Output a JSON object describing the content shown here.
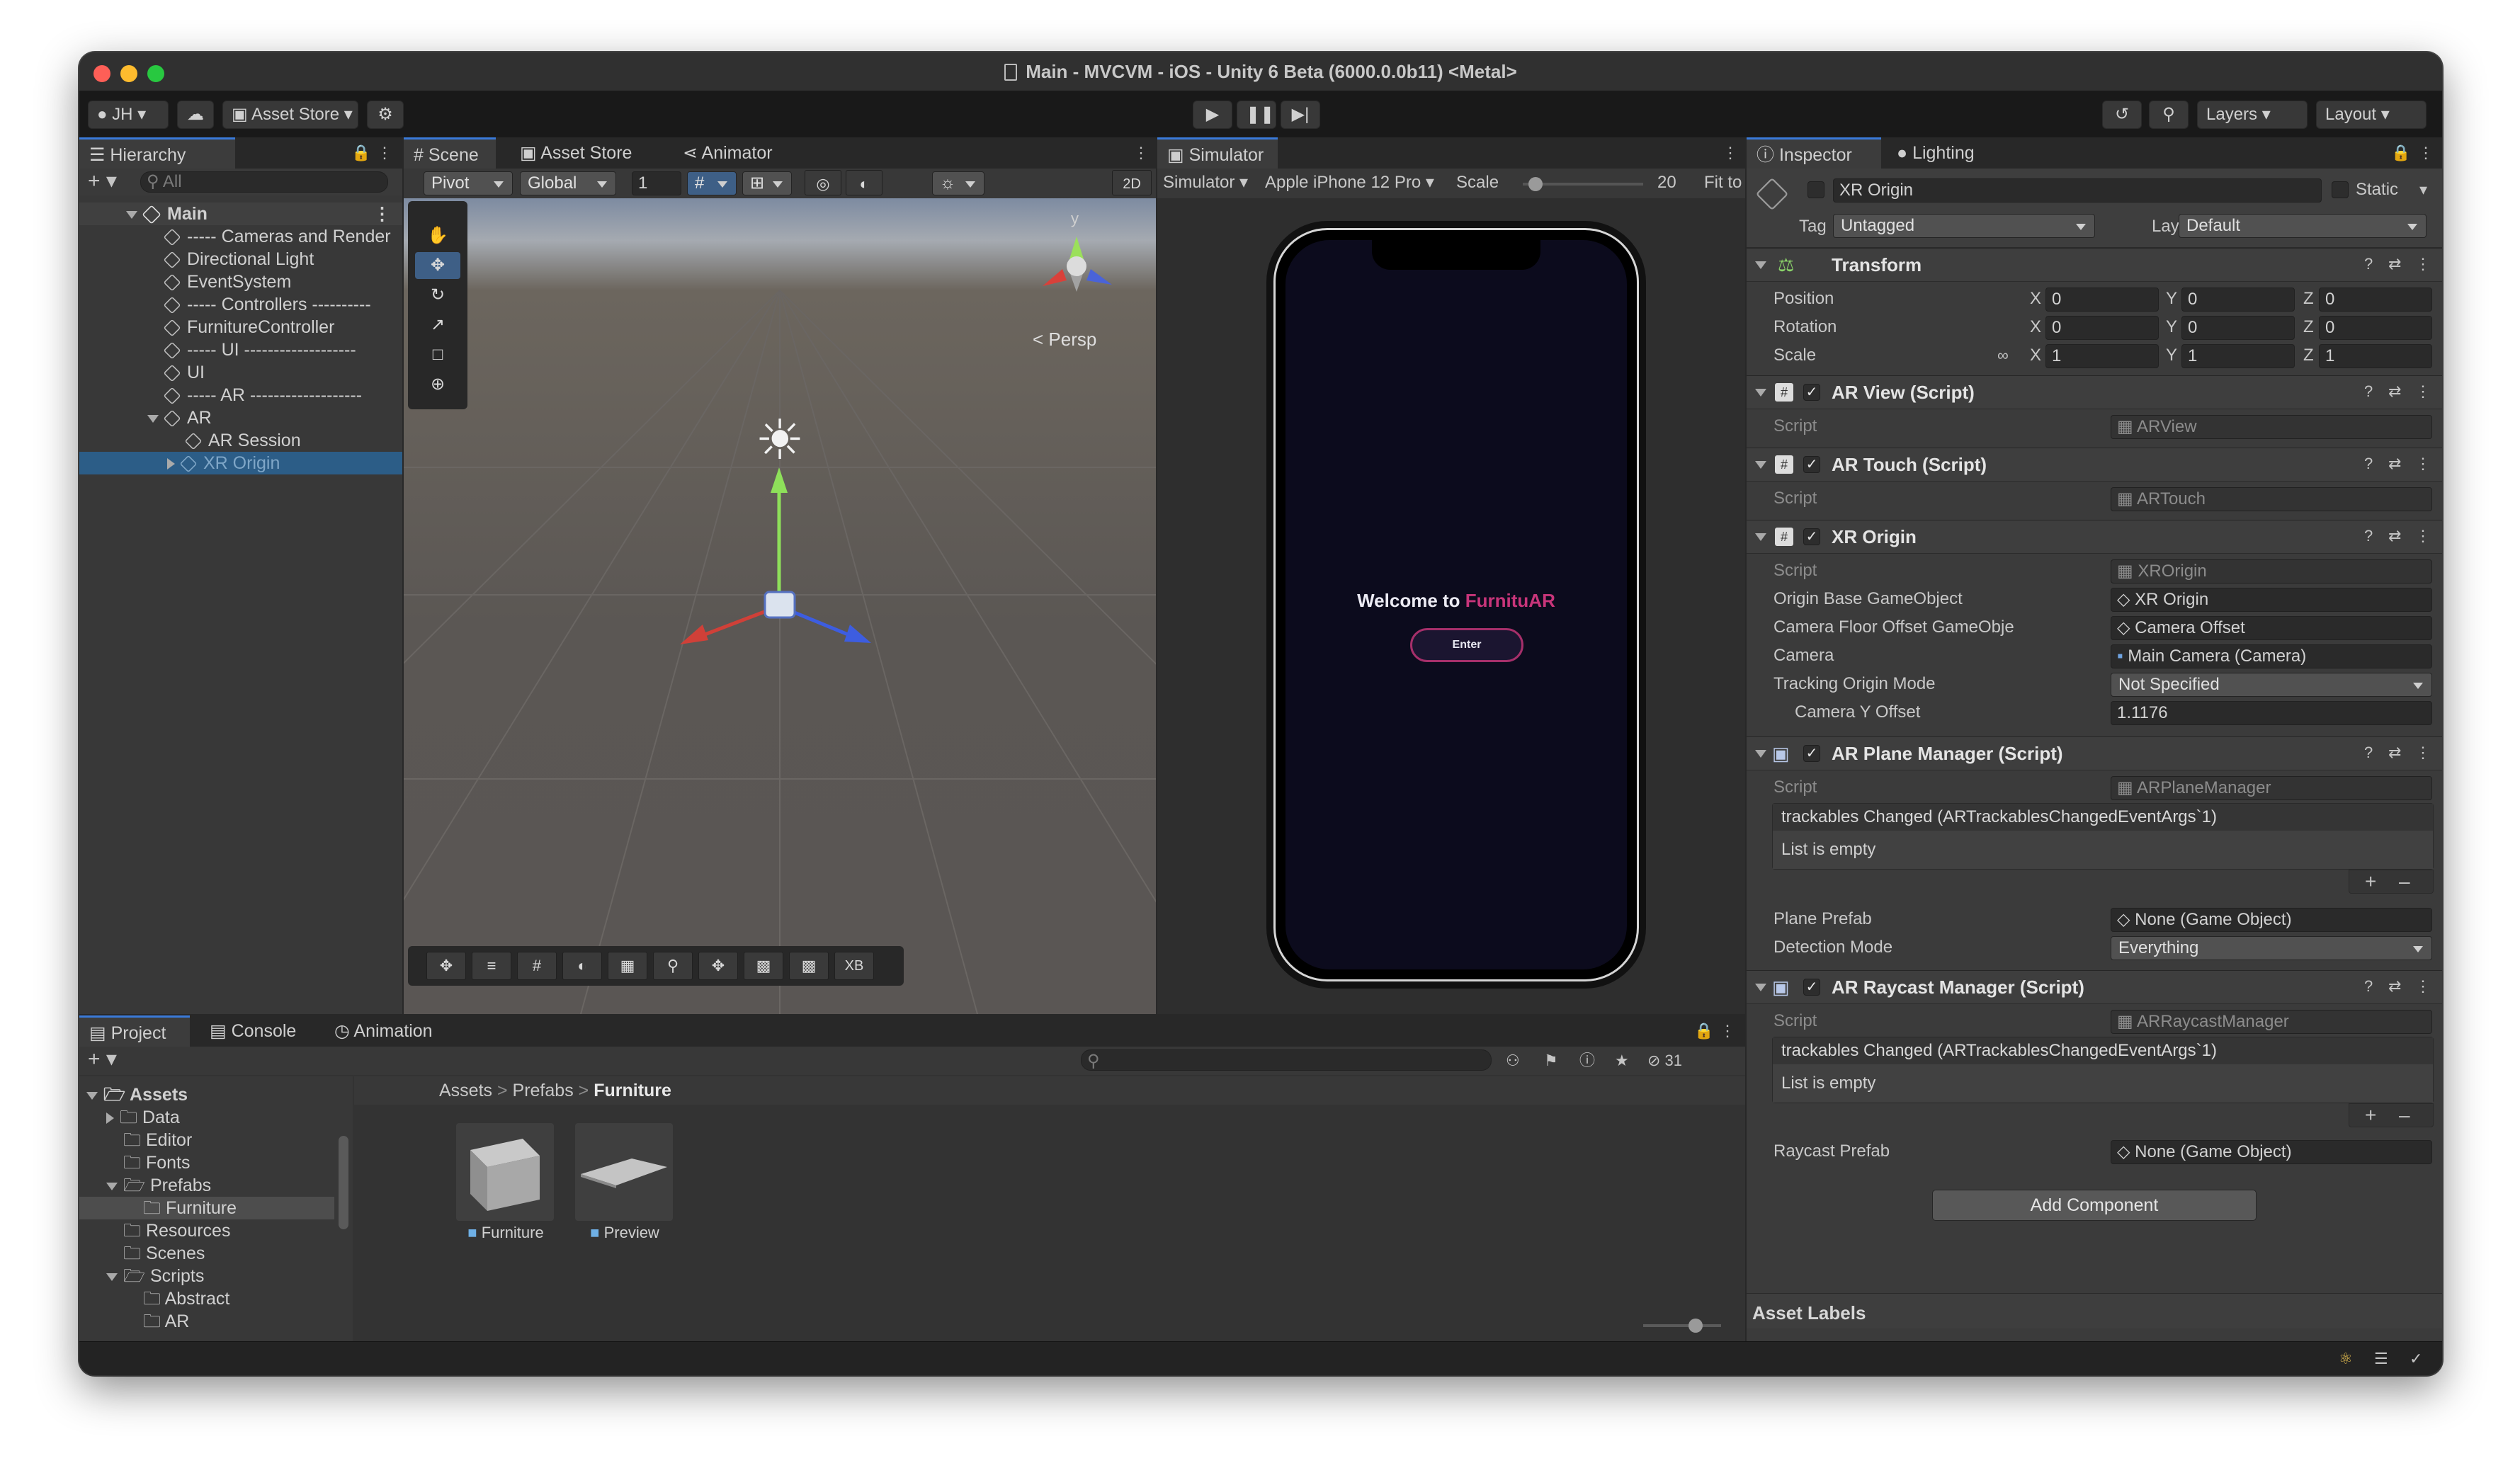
{
  "window": {
    "title": "Main - MVCVM - iOS - Unity 6 Beta (6000.0.0b11) <Metal>"
  },
  "toolbar": {
    "account": "JH",
    "asset_store": "Asset Store",
    "layers": "Layers",
    "layout": "Layout"
  },
  "hierarchy": {
    "tab": "Hierarchy",
    "search_placeholder": "All",
    "root": "Main",
    "items": [
      "----- Cameras and Render",
      "Directional Light",
      "EventSystem",
      "----- Controllers ----------",
      "FurnitureController",
      "----- UI -------------------",
      "UI",
      "----- AR -------------------",
      "AR",
      "AR Session",
      "XR Origin"
    ]
  },
  "scene": {
    "tabs": [
      "Scene",
      "Asset Store",
      "Animator"
    ],
    "pivot": "Pivot",
    "global": "Global",
    "grid_value": "1",
    "mode_2d": "2D",
    "persp": "< Persp",
    "gizmo_y": "y",
    "bottom_xb": "XB"
  },
  "simulator": {
    "tab": "Simulator",
    "mode": "Simulator",
    "device": "Apple iPhone 12 Pro",
    "scale_label": "Scale",
    "scale_value": "20",
    "fit": "Fit to",
    "welcome_prefix": "Welcome to ",
    "welcome_brand": "FurnituAR",
    "enter_button": "Enter",
    "brand_color": "#c8357a"
  },
  "project": {
    "tabs": [
      "Project",
      "Console",
      "Animation"
    ],
    "hidden_count": "31",
    "breadcrumb": [
      "Assets",
      "Prefabs",
      "Furniture"
    ],
    "tree": [
      "Assets",
      "Data",
      "Editor",
      "Fonts",
      "Prefabs",
      "Furniture",
      "Resources",
      "Scenes",
      "Scripts",
      "Abstract",
      "AR"
    ],
    "assets": [
      "Furniture",
      "Preview"
    ]
  },
  "inspector": {
    "tabs": [
      "Inspector",
      "Lighting"
    ],
    "object_name": "XR Origin",
    "static": "Static",
    "tag_label": "Tag",
    "tag": "Untagged",
    "layer_label": "Layer",
    "layer": "Default",
    "transform": {
      "title": "Transform",
      "rows": [
        {
          "label": "Position",
          "x": "0",
          "y": "0",
          "z": "0"
        },
        {
          "label": "Rotation",
          "x": "0",
          "y": "0",
          "z": "0"
        },
        {
          "label": "Scale",
          "x": "1",
          "y": "1",
          "z": "1"
        }
      ],
      "axis": [
        "X",
        "Y",
        "Z"
      ]
    },
    "ar_view": {
      "title": "AR View (Script)",
      "script_label": "Script",
      "script": "ARView"
    },
    "ar_touch": {
      "title": "AR Touch (Script)",
      "script_label": "Script",
      "script": "ARTouch"
    },
    "xr_origin": {
      "title": "XR Origin",
      "script_label": "Script",
      "script": "XROrigin",
      "origin_base_label": "Origin Base GameObject",
      "origin_base": "XR Origin",
      "camera_floor_label": "Camera Floor Offset GameObje",
      "camera_floor": "Camera Offset",
      "camera_label": "Camera",
      "camera": "Main Camera (Camera)",
      "tracking_label": "Tracking Origin Mode",
      "tracking": "Not Specified",
      "y_offset_label": "Camera Y Offset",
      "y_offset": "1.1176"
    },
    "plane_manager": {
      "title": "AR Plane Manager (Script)",
      "script_label": "Script",
      "script": "ARPlaneManager",
      "event": "trackables Changed (ARTrackablesChangedEventArgs`1)",
      "list_empty": "List is empty",
      "prefab_label": "Plane Prefab",
      "prefab": "None (Game Object)",
      "detection_label": "Detection Mode",
      "detection": "Everything"
    },
    "raycast_manager": {
      "title": "AR Raycast Manager (Script)",
      "script_label": "Script",
      "script": "ARRaycastManager",
      "event": "trackables Changed (ARTrackablesChangedEventArgs`1)",
      "list_empty": "List is empty",
      "prefab_label": "Raycast Prefab",
      "prefab": "None (Game Object)"
    },
    "add_component": "Add Component",
    "asset_labels": "Asset Labels"
  }
}
